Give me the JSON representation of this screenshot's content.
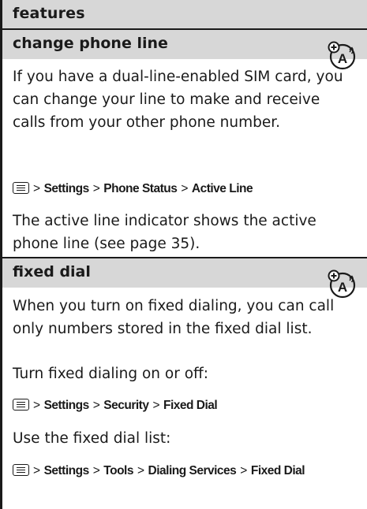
{
  "header": {
    "title": "features"
  },
  "sections": [
    {
      "heading": "change phone line",
      "icon": "network-feature-icon",
      "body": "If you have a dual-line-enabled SIM card, you can change your line to make and receive calls from your other phone number.",
      "path": [
        "Settings",
        "Phone Status",
        "Active Line"
      ],
      "note": "The active line indicator shows the active phone line (see page 35)."
    },
    {
      "heading": "fixed dial",
      "icon": "network-feature-icon",
      "body": "When you turn on fixed dialing, you can call only numbers stored in the fixed dial list.",
      "instr1": "Turn fixed dialing on or off:",
      "path1": [
        "Settings",
        "Security",
        "Fixed Dial"
      ],
      "instr2": "Use the fixed dial list:",
      "path2": [
        "Settings",
        "Tools",
        "Dialing Services",
        "Fixed Dial"
      ]
    }
  ],
  "menu_separator": ">",
  "menu_key_icon": "menu-key-icon"
}
